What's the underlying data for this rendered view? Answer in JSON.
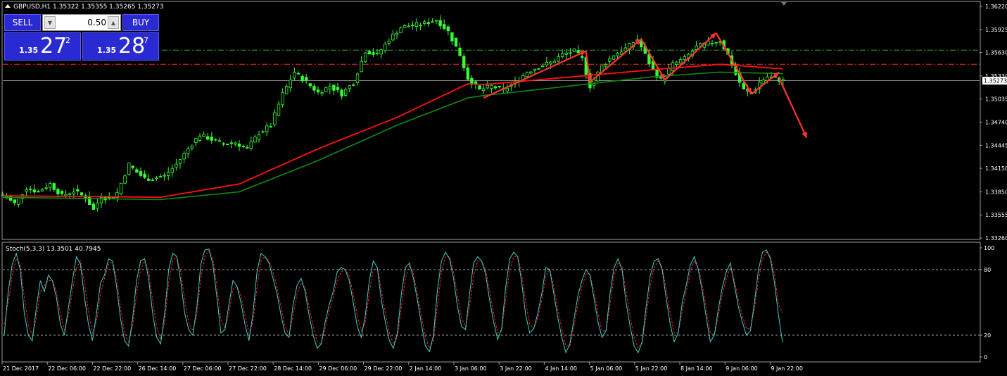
{
  "header": {
    "symbol_info": "GBPUSD,H1  1.35322 1.35355 1.35265 1.35273"
  },
  "trade_panel": {
    "sell_label": "SELL",
    "buy_label": "BUY",
    "volume": "0.50",
    "sell_price": {
      "prefix": "1.35",
      "big": "27",
      "sup": "2"
    },
    "buy_price": {
      "prefix": "1.35",
      "big": "28",
      "sup": "7"
    }
  },
  "colors": {
    "bull_candle": "#33ff33",
    "ma_fast": "#ff1010",
    "ma_slow": "#108a10",
    "arrows": "#ff3333",
    "stoch_main": "#40d0d0",
    "stoch_signal": "#ff2020",
    "grid_text": "#ffffff"
  },
  "chart_data": [
    {
      "type": "candlestick",
      "symbol": "GBPUSD",
      "timeframe": "H1",
      "current_price_label": "1.35273",
      "y_ticks": [
        "1.36220",
        "1.35925",
        "1.35630",
        "1.35330",
        "1.35035",
        "1.34740",
        "1.34445",
        "1.34150",
        "1.33850",
        "1.33555",
        "1.33260"
      ],
      "ylim": [
        1.3326,
        1.3622
      ],
      "x_ticks": [
        "21 Dec 2017",
        "22 Dec 06:00",
        "22 Dec 22:00",
        "26 Dec 14:00",
        "27 Dec 06:00",
        "27 Dec 22:00",
        "28 Dec 14:00",
        "29 Dec 06:00",
        "29 Dec 22:00",
        "2 Jan 14:00",
        "3 Jan 06:00",
        "3 Jan 22:00",
        "4 Jan 14:00",
        "5 Jan 06:00",
        "5 Jan 22:00",
        "8 Jan 14:00",
        "9 Jan 06:00",
        "9 Jan 22:00"
      ],
      "price_path": [
        [
          0,
          1.3381
        ],
        [
          3,
          1.337
        ],
        [
          6,
          1.339
        ],
        [
          9,
          1.3385
        ],
        [
          12,
          1.3395
        ],
        [
          15,
          1.338
        ],
        [
          18,
          1.3386
        ],
        [
          21,
          1.3378
        ],
        [
          23,
          1.3362
        ],
        [
          25,
          1.338
        ],
        [
          27,
          1.3375
        ],
        [
          29,
          1.3384
        ],
        [
          32,
          1.342
        ],
        [
          34,
          1.341
        ],
        [
          36,
          1.3402
        ],
        [
          38,
          1.3402
        ],
        [
          41,
          1.3405
        ],
        [
          44,
          1.342
        ],
        [
          47,
          1.344
        ],
        [
          50,
          1.3458
        ],
        [
          53,
          1.3452
        ],
        [
          56,
          1.3446
        ],
        [
          59,
          1.3448
        ],
        [
          62,
          1.344
        ],
        [
          65,
          1.346
        ],
        [
          68,
          1.347
        ],
        [
          71,
          1.351
        ],
        [
          74,
          1.3538
        ],
        [
          77,
          1.3525
        ],
        [
          80,
          1.3512
        ],
        [
          83,
          1.352
        ],
        [
          86,
          1.351
        ],
        [
          89,
          1.3525
        ],
        [
          92,
          1.3565
        ],
        [
          95,
          1.356
        ],
        [
          98,
          1.358
        ],
        [
          101,
          1.3595
        ],
        [
          104,
          1.3598
        ],
        [
          107,
          1.36
        ],
        [
          110,
          1.3605
        ],
        [
          113,
          1.359
        ],
        [
          116,
          1.356
        ],
        [
          118,
          1.353
        ],
        [
          121,
          1.3515
        ],
        [
          124,
          1.352
        ],
        [
          127,
          1.3515
        ],
        [
          130,
          1.3525
        ],
        [
          133,
          1.3538
        ],
        [
          136,
          1.3545
        ],
        [
          139,
          1.355
        ],
        [
          142,
          1.356
        ],
        [
          145,
          1.3565
        ],
        [
          147,
          1.3555
        ],
        [
          149,
          1.352
        ],
        [
          152,
          1.3545
        ],
        [
          155,
          1.356
        ],
        [
          158,
          1.3568
        ],
        [
          161,
          1.358
        ],
        [
          163,
          1.356
        ],
        [
          165,
          1.354
        ],
        [
          167,
          1.3528
        ],
        [
          170,
          1.3548
        ],
        [
          173,
          1.3555
        ],
        [
          176,
          1.357
        ],
        [
          179,
          1.3575
        ],
        [
          182,
          1.3578
        ],
        [
          184,
          1.356
        ],
        [
          186,
          1.3535
        ],
        [
          188,
          1.3515
        ],
        [
          190,
          1.351
        ],
        [
          192,
          1.3525
        ],
        [
          194,
          1.3532
        ],
        [
          196,
          1.353
        ],
        [
          198,
          1.3527
        ]
      ],
      "ma_fast": [
        [
          0,
          1.338
        ],
        [
          40,
          1.3378
        ],
        [
          60,
          1.3395
        ],
        [
          80,
          1.344
        ],
        [
          100,
          1.348
        ],
        [
          118,
          1.3523
        ],
        [
          122,
          1.3522
        ],
        [
          140,
          1.353
        ],
        [
          165,
          1.3541
        ],
        [
          182,
          1.3548
        ],
        [
          198,
          1.3542
        ]
      ],
      "ma_slow": [
        [
          0,
          1.3378
        ],
        [
          40,
          1.3375
        ],
        [
          60,
          1.3385
        ],
        [
          80,
          1.3425
        ],
        [
          100,
          1.347
        ],
        [
          118,
          1.3505
        ],
        [
          122,
          1.3508
        ],
        [
          140,
          1.3518
        ],
        [
          165,
          1.3532
        ],
        [
          182,
          1.3538
        ],
        [
          198,
          1.3536
        ]
      ],
      "levels": [
        1.3566,
        1.3548,
        1.3527
      ],
      "arrows": [
        [
          [
            122,
            1.3505
          ],
          [
            148,
            1.3565
          ]
        ],
        [
          [
            148,
            1.3565
          ],
          [
            149,
            1.3525
          ]
        ],
        [
          [
            149,
            1.3525
          ],
          [
            162,
            1.358
          ]
        ],
        [
          [
            162,
            1.358
          ],
          [
            168,
            1.3528
          ]
        ],
        [
          [
            168,
            1.3528
          ],
          [
            181,
            1.3588
          ]
        ],
        [
          [
            181,
            1.3588
          ],
          [
            190,
            1.351
          ]
        ],
        [
          [
            190,
            1.351
          ],
          [
            197,
            1.3538
          ]
        ],
        [
          [
            197,
            1.353
          ],
          [
            204,
            1.3454
          ]
        ]
      ],
      "x_count": 214
    },
    {
      "type": "line",
      "title": "Stoch(5,3,3) 13.3501 40.7945",
      "y_ticks": [
        "100",
        "80",
        "20",
        "0"
      ],
      "ylim": [
        0,
        100
      ],
      "levels": [
        80,
        20
      ],
      "series": [
        {
          "name": "main",
          "values": [
            20,
            60,
            85,
            95,
            80,
            40,
            20,
            15,
            45,
            70,
            60,
            75,
            70,
            55,
            30,
            20,
            45,
            70,
            92,
            85,
            55,
            30,
            15,
            40,
            68,
            75,
            90,
            88,
            65,
            35,
            15,
            10,
            35,
            70,
            88,
            90,
            72,
            40,
            18,
            12,
            40,
            80,
            95,
            92,
            70,
            40,
            25,
            20,
            45,
            85,
            98,
            99,
            85,
            55,
            22,
            25,
            48,
            70,
            65,
            50,
            30,
            15,
            40,
            78,
            95,
            92,
            86,
            72,
            58,
            38,
            22,
            18,
            48,
            66,
            72,
            60,
            38,
            20,
            8,
            12,
            32,
            48,
            60,
            78,
            82,
            80,
            70,
            50,
            28,
            18,
            38,
            70,
            88,
            82,
            52,
            32,
            15,
            8,
            22,
            58,
            82,
            86,
            72,
            52,
            30,
            10,
            5,
            20,
            62,
            88,
            96,
            90,
            72,
            46,
            28,
            25,
            58,
            86,
            92,
            88,
            76,
            52,
            32,
            16,
            26,
            64,
            90,
            96,
            92,
            68,
            38,
            22,
            26,
            40,
            58,
            82,
            80,
            58,
            36,
            18,
            4,
            12,
            34,
            56,
            70,
            80,
            75,
            54,
            32,
            18,
            24,
            58,
            82,
            90,
            80,
            50,
            28,
            10,
            4,
            14,
            46,
            74,
            88,
            90,
            80,
            54,
            30,
            14,
            22,
            50,
            66,
            84,
            92,
            80,
            60,
            36,
            14,
            20,
            44,
            64,
            78,
            86,
            66,
            46,
            32,
            20,
            24,
            50,
            80,
            96,
            98,
            90,
            68,
            38,
            13.35
          ]
        },
        {
          "name": "signal",
          "values": [
            30,
            50,
            75,
            90,
            85,
            55,
            30,
            20,
            35,
            60,
            65,
            70,
            70,
            60,
            40,
            25,
            38,
            60,
            82,
            88,
            68,
            42,
            22,
            32,
            58,
            72,
            85,
            88,
            72,
            45,
            22,
            14,
            28,
            58,
            80,
            88,
            80,
            52,
            28,
            16,
            32,
            68,
            88,
            92,
            78,
            52,
            32,
            24,
            38,
            72,
            92,
            97,
            90,
            65,
            35,
            26,
            40,
            62,
            65,
            56,
            38,
            22,
            32,
            64,
            88,
            92,
            88,
            78,
            64,
            46,
            28,
            20,
            38,
            58,
            68,
            64,
            46,
            28,
            14,
            12,
            26,
            42,
            55,
            70,
            78,
            80,
            74,
            58,
            38,
            24,
            32,
            58,
            80,
            82,
            62,
            40,
            22,
            12,
            18,
            46,
            72,
            84,
            76,
            58,
            38,
            18,
            8,
            15,
            48,
            78,
            92,
            92,
            78,
            56,
            36,
            28,
            46,
            74,
            88,
            88,
            80,
            60,
            40,
            22,
            24,
            52,
            80,
            92,
            92,
            76,
            50,
            30,
            26,
            36,
            52,
            74,
            80,
            64,
            44,
            26,
            10,
            10,
            28,
            48,
            64,
            76,
            76,
            60,
            40,
            24,
            24,
            48,
            74,
            86,
            82,
            60,
            38,
            18,
            8,
            12,
            38,
            64,
            82,
            88,
            82,
            62,
            40,
            22,
            22,
            42,
            60,
            78,
            88,
            82,
            66,
            44,
            22,
            20,
            38,
            58,
            72,
            82,
            70,
            52,
            38,
            26,
            26,
            44,
            70,
            90,
            96,
            92,
            76,
            48,
            40.79
          ]
        }
      ]
    }
  ]
}
